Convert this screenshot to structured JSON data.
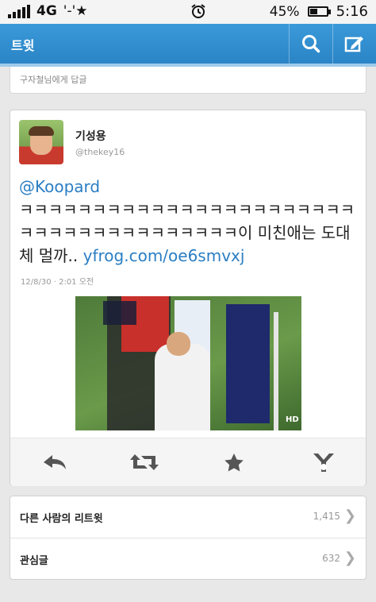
{
  "status_bar": {
    "network": "4G",
    "carrier_glyphs": "'-'★",
    "alarm_icon": "alarm-clock-icon",
    "battery": "45%",
    "battery_level": 0.45,
    "time": "5:16"
  },
  "header": {
    "title": "트윗",
    "search_icon": "search-icon",
    "compose_icon": "compose-icon",
    "color": "#2f8ed0"
  },
  "reply_bar": {
    "label": "구자철님에게 답글"
  },
  "tweet": {
    "author_name": "기성용",
    "author_handle": "@thekey16",
    "mention": "@Koopard",
    "body": "ㅋㅋㅋㅋㅋㅋㅋㅋㅋㅋㅋㅋㅋㅋㅋㅋㅋㅋㅋㅋㅋㅋㅋㅋㅋㅋㅋㅋㅋㅋㅋㅋㅋㅋㅋㅋㅋㅋ이 미친애는 도대체 멀까..",
    "link": "yfrog.com/oe6smvxj",
    "timestamp": "12/8/30 · 2:01 오전",
    "photo_overlay": "HD",
    "link_color": "#2a7ec3"
  },
  "actions": [
    {
      "icon": "reply-icon"
    },
    {
      "icon": "retweet-icon"
    },
    {
      "icon": "favorite-star-icon"
    },
    {
      "icon": "share-icon"
    }
  ],
  "stats": [
    {
      "label": "다른 사람의 리트윗",
      "count": "1,415"
    },
    {
      "label": "관심글",
      "count": "632"
    }
  ]
}
